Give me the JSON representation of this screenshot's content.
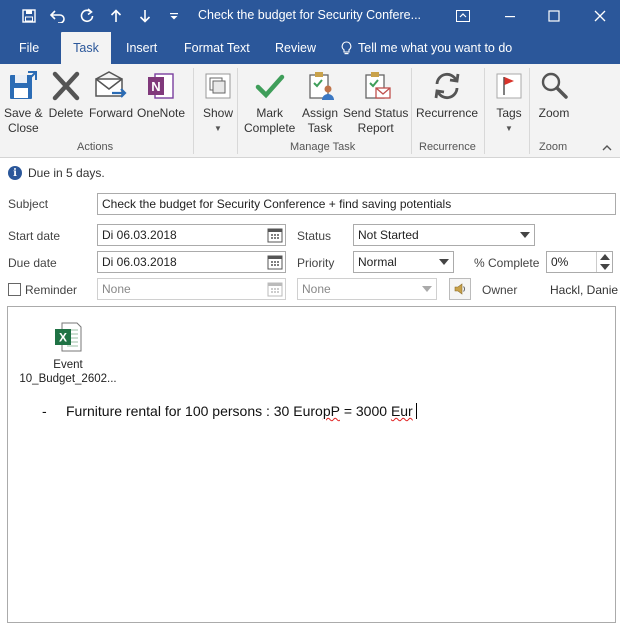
{
  "window": {
    "title": "Check the budget for Security Confere..."
  },
  "tabs": [
    {
      "label": "File"
    },
    {
      "label": "Task"
    },
    {
      "label": "Insert"
    },
    {
      "label": "Format Text"
    },
    {
      "label": "Review"
    },
    {
      "label": "Tell me what you want to do"
    }
  ],
  "ribbon": {
    "actions": {
      "group_label": "Actions",
      "save_close_line1": "Save &",
      "save_close_line2": "Close",
      "delete": "Delete",
      "forward": "Forward",
      "onenote": "OneNote"
    },
    "show": {
      "label": "Show"
    },
    "manage": {
      "group_label": "Manage Task",
      "mark_complete_line1": "Mark",
      "mark_complete_line2": "Complete",
      "assign_line1": "Assign",
      "assign_line2": "Task",
      "send_status_line1": "Send Status",
      "send_status_line2": "Report"
    },
    "recurrence": {
      "group_label": "Recurrence",
      "label": "Recurrence"
    },
    "tags": {
      "label": "Tags"
    },
    "zoom": {
      "group_label": "Zoom",
      "label": "Zoom"
    }
  },
  "info": {
    "text": "Due in 5 days."
  },
  "form": {
    "subject_label": "Subject",
    "subject_value": "Check the budget for Security Conference + find saving potentials",
    "start_label": "Start date",
    "start_value": "Di 06.03.2018",
    "due_label": "Due date",
    "due_value": "Di 06.03.2018",
    "status_label": "Status",
    "status_value": "Not Started",
    "priority_label": "Priority",
    "priority_value": "Normal",
    "complete_label": "% Complete",
    "complete_value": "0%",
    "reminder_label": "Reminder",
    "reminder_date": "None",
    "reminder_time": "None",
    "owner_label": "Owner",
    "owner_value": "Hackl, Danie"
  },
  "body": {
    "attachment_line1": "Event",
    "attachment_line2": "10_Budget_2602...",
    "bullet": "-",
    "line_main": "Furniture rental for 100 persons : 30 Euro ",
    "line_pp": "pP",
    "line_mid": " = 3000 ",
    "line_eur": "Eur"
  }
}
